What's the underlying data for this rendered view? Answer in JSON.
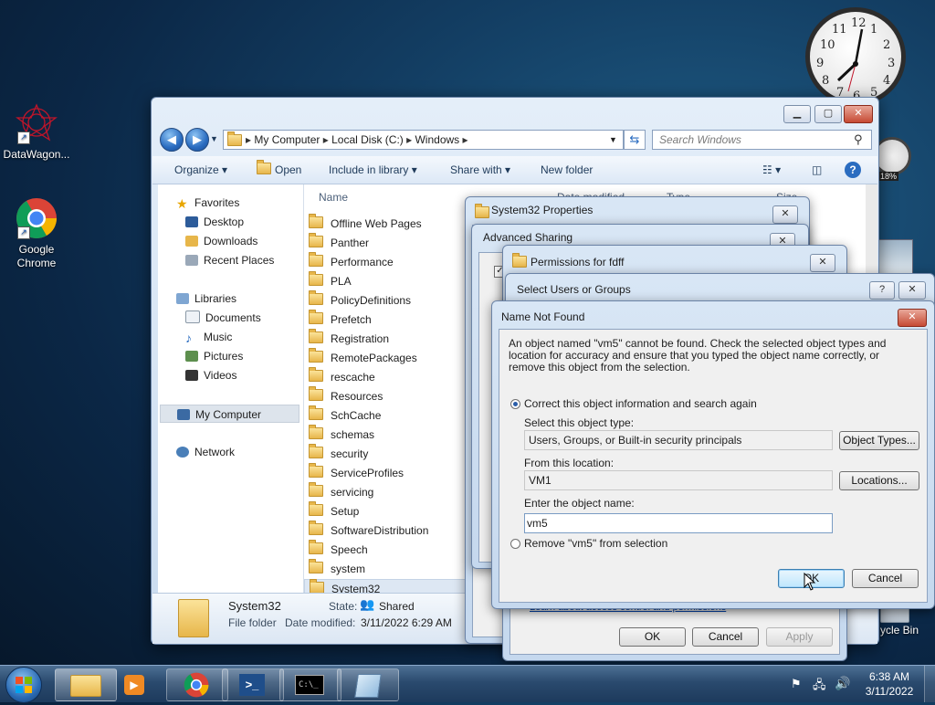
{
  "desktop": {
    "icons": [
      {
        "label": "DataWagon..."
      },
      {
        "label": "Google Chrome"
      }
    ],
    "recycle_bin_label": "ycle Bin",
    "gadget_clock_numbers": [
      "12",
      "1",
      "2",
      "3",
      "4",
      "5",
      "6",
      "7",
      "8",
      "9",
      "10",
      "11"
    ],
    "gadget_cpu_text": "18%"
  },
  "explorer": {
    "breadcrumb": [
      "My Computer",
      "Local Disk (C:)",
      "Windows"
    ],
    "search_placeholder": "Search Windows",
    "toolbar": {
      "organize": "Organize",
      "open": "Open",
      "include": "Include in library",
      "share": "Share with",
      "newfolder": "New folder"
    },
    "nav": {
      "favorites": "Favorites",
      "desktop": "Desktop",
      "downloads": "Downloads",
      "recent": "Recent Places",
      "libraries": "Libraries",
      "documents": "Documents",
      "music": "Music",
      "pictures": "Pictures",
      "videos": "Videos",
      "mycomputer": "My Computer",
      "network": "Network"
    },
    "columns": {
      "name": "Name",
      "date": "Date modified",
      "type": "Type",
      "size": "Size"
    },
    "files": [
      "Offline Web Pages",
      "Panther",
      "Performance",
      "PLA",
      "PolicyDefinitions",
      "Prefetch",
      "Registration",
      "RemotePackages",
      "rescache",
      "Resources",
      "SchCache",
      "schemas",
      "security",
      "ServiceProfiles",
      "servicing",
      "Setup",
      "SoftwareDistribution",
      "Speech",
      "system",
      "System32"
    ],
    "details": {
      "name": "System32",
      "type": "File folder",
      "state_label": "State:",
      "state_value": "Shared",
      "modified_label": "Date modified:",
      "modified_value": "3/11/2022 6:29 AM"
    }
  },
  "props_dialog": {
    "title": "System32 Properties"
  },
  "adv_dialog": {
    "title": "Advanced Sharing"
  },
  "perm_dialog": {
    "title": "Permissions for fdff",
    "link": "Learn about access control and permissions",
    "ok": "OK",
    "cancel": "Cancel",
    "apply": "Apply"
  },
  "select_dialog": {
    "title": "Select Users or Groups",
    "help": "?"
  },
  "notfound_dialog": {
    "title": "Name Not Found",
    "message": "An object named \"vm5\" cannot be found. Check the selected object types and location for accuracy and ensure that you typed the object name correctly, or remove this object from the selection.",
    "correct_option": "Correct this object information and search again",
    "type_label": "Select this object type:",
    "type_value": "Users, Groups, or Built-in security principals",
    "object_types_btn": "Object Types...",
    "location_label": "From this location:",
    "location_value": "VM1",
    "locations_btn": "Locations...",
    "name_label": "Enter the object name:",
    "name_value": "vm5",
    "remove_option": "Remove \"vm5\" from selection",
    "ok": "OK",
    "cancel": "Cancel"
  },
  "taskbar": {
    "time": "6:38 AM",
    "date": "3/11/2022"
  }
}
